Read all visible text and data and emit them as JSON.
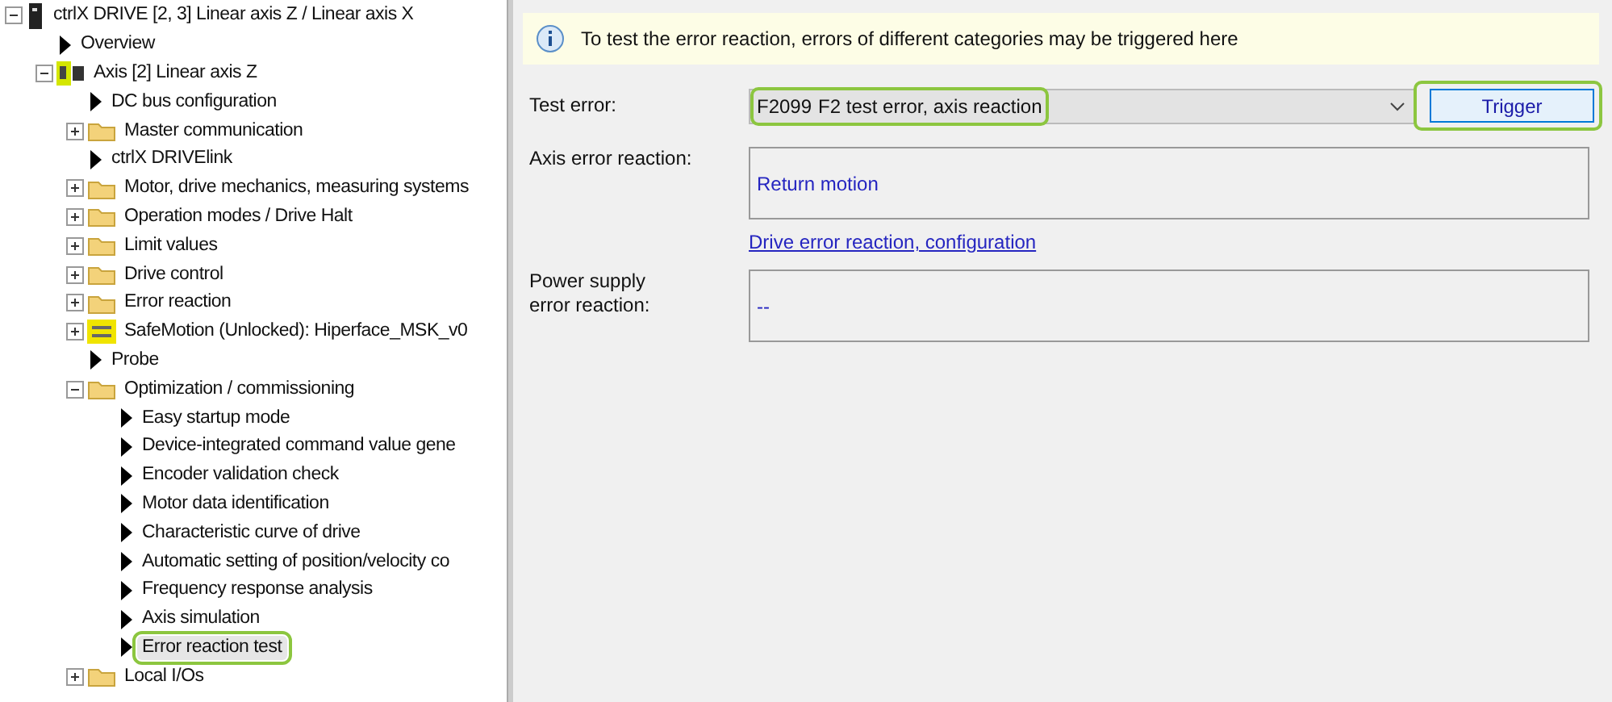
{
  "tree": [
    {
      "label": "ctrlX DRIVE [2, 3] Linear axis Z / Linear axis X",
      "kind": "drive",
      "expanded": true,
      "selected": false,
      "highlighted": false,
      "children": [
        {
          "label": "Overview",
          "kind": "page",
          "selected": false,
          "highlighted": false
        },
        {
          "label": "Axis [2] Linear axis Z",
          "kind": "axis",
          "expanded": true,
          "selected": false,
          "highlighted": false,
          "children": [
            {
              "label": "DC bus configuration",
              "kind": "page",
              "selected": false,
              "highlighted": false
            },
            {
              "label": "Master communication",
              "kind": "folder",
              "expanded": false,
              "selected": false,
              "highlighted": false
            },
            {
              "label": "ctrlX DRIVElink",
              "kind": "page",
              "selected": false,
              "highlighted": false
            },
            {
              "label": "Motor, drive mechanics, measuring systems",
              "kind": "folder",
              "expanded": false,
              "selected": false,
              "highlighted": false
            },
            {
              "label": "Operation modes / Drive Halt",
              "kind": "folder",
              "expanded": false,
              "selected": false,
              "highlighted": false
            },
            {
              "label": "Limit values",
              "kind": "folder",
              "expanded": false,
              "selected": false,
              "highlighted": false
            },
            {
              "label": "Drive control",
              "kind": "folder",
              "expanded": false,
              "selected": false,
              "highlighted": false
            },
            {
              "label": "Error reaction",
              "kind": "folder",
              "expanded": false,
              "selected": false,
              "highlighted": false
            },
            {
              "label": "SafeMotion (Unlocked): Hiperface_MSK_v0",
              "kind": "safety",
              "expanded": false,
              "selected": false,
              "highlighted": false
            },
            {
              "label": "Probe",
              "kind": "page",
              "selected": false,
              "highlighted": false
            },
            {
              "label": "Optimization / commissioning",
              "kind": "folder",
              "expanded": true,
              "selected": false,
              "highlighted": false,
              "children": [
                {
                  "label": "Easy startup mode",
                  "kind": "page",
                  "selected": false,
                  "highlighted": false
                },
                {
                  "label": "Device-integrated command value gene",
                  "kind": "page",
                  "selected": false,
                  "highlighted": false
                },
                {
                  "label": "Encoder validation check",
                  "kind": "page",
                  "selected": false,
                  "highlighted": false
                },
                {
                  "label": "Motor data identification",
                  "kind": "page",
                  "selected": false,
                  "highlighted": false
                },
                {
                  "label": "Characteristic curve of drive",
                  "kind": "page",
                  "selected": false,
                  "highlighted": false
                },
                {
                  "label": "Automatic setting of position/velocity co",
                  "kind": "page",
                  "selected": false,
                  "highlighted": false
                },
                {
                  "label": "Frequency response analysis",
                  "kind": "page",
                  "selected": false,
                  "highlighted": false
                },
                {
                  "label": "Axis simulation",
                  "kind": "page",
                  "selected": false,
                  "highlighted": false
                },
                {
                  "label": "Error reaction test",
                  "kind": "page",
                  "selected": true,
                  "highlighted": true
                }
              ]
            },
            {
              "label": "Local I/Os",
              "kind": "folder",
              "expanded": false,
              "selected": false,
              "highlighted": false
            }
          ]
        }
      ]
    }
  ],
  "info_bar": {
    "text": "To test the error reaction, errors of different categories may be triggered here"
  },
  "test_error": {
    "label": "Test error:",
    "code": "F2099",
    "value": "F2 test error, axis reaction",
    "highlighted": true
  },
  "trigger_button": {
    "label": "Trigger",
    "highlighted": true
  },
  "axis_error_reaction": {
    "label": "Axis error reaction:",
    "value": "Return motion"
  },
  "config_link": "Drive error reaction, configuration",
  "power_supply_error_reaction": {
    "label": "Power supply\nerror reaction:",
    "value": "--"
  }
}
